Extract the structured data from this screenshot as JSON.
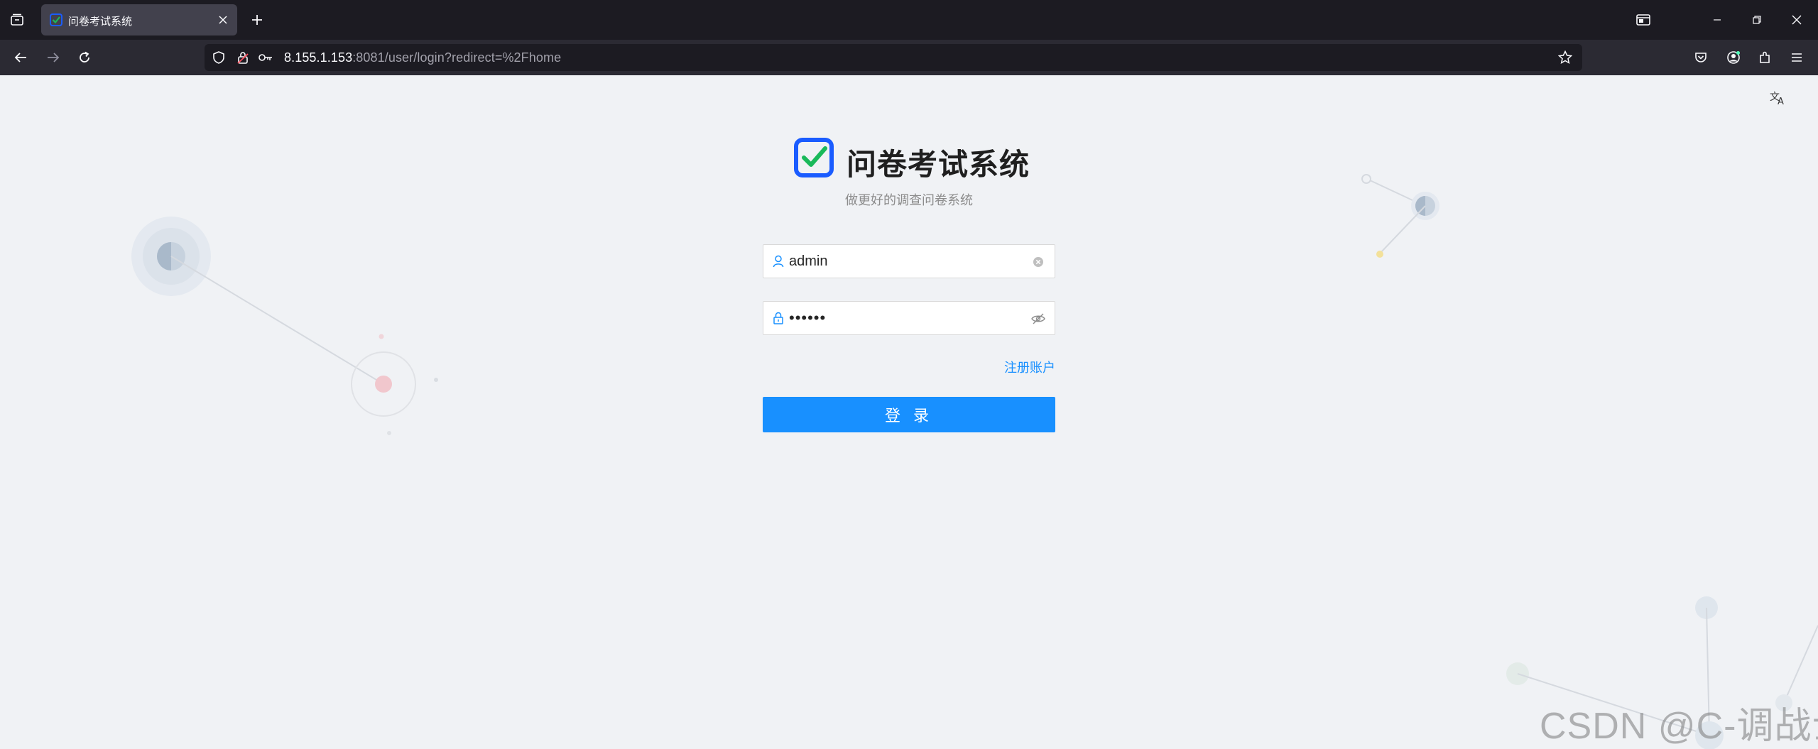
{
  "browser": {
    "tab": {
      "title": "问卷考试系统"
    },
    "url": {
      "host": "8.155.1.153",
      "path": ":8081/user/login?redirect=%2Fhome"
    }
  },
  "login": {
    "app_title": "问卷考试系统",
    "subtitle": "做更好的调查问卷系统",
    "username_value": "admin",
    "password_value": "••••••",
    "register_link": "注册账户",
    "login_button": "登 录"
  },
  "watermark": "CSDN @C-调战士",
  "colors": {
    "primary": "#1890ff",
    "logo_blue": "#1a5cff",
    "logo_check": "#19b95a"
  }
}
